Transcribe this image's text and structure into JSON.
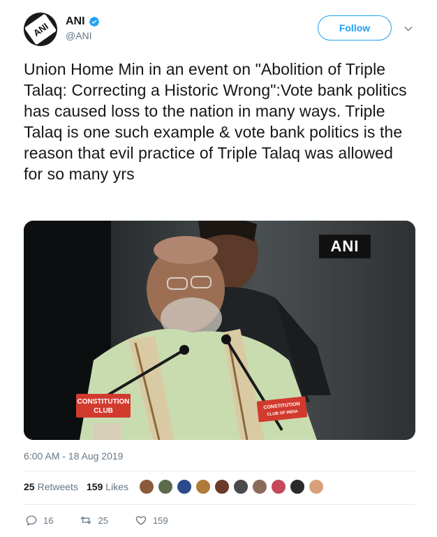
{
  "account": {
    "display_name": "ANI",
    "handle": "@ANI",
    "avatar_text": "ANI",
    "verified": true
  },
  "follow_label": "Follow",
  "tweet_text": "Union Home Min in an event on \"Abolition of Triple Talaq: Correcting a Historic Wrong\":Vote bank politics has caused loss to the nation in many ways. Triple Talaq is one such example & vote bank politics is the reason that evil practice of Triple Talaq was allowed for so many yrs",
  "media": {
    "watermark": "ANI",
    "podium_sign_left": "CONSTITUTION CLUB",
    "podium_sign_right": "CONSTITUTION CLUB OF INDIA"
  },
  "timestamp": "6:00 AM - 18 Aug 2019",
  "stats": {
    "retweets_count": "25",
    "retweets_label": "Retweets",
    "likes_count": "159",
    "likes_label": "Likes"
  },
  "liker_avatar_colors": [
    "#8a5a3c",
    "#5c6b4a",
    "#2c4a8a",
    "#b07a3a",
    "#6a3a2a",
    "#4a4a4a",
    "#8a6a5a",
    "#c44a5a",
    "#2a2a2a",
    "#d8a07a"
  ],
  "actions": {
    "replies": "16",
    "retweets": "25",
    "likes": "159"
  },
  "colors": {
    "accent": "#1da1f2",
    "text": "#14171a",
    "muted": "#657786"
  }
}
